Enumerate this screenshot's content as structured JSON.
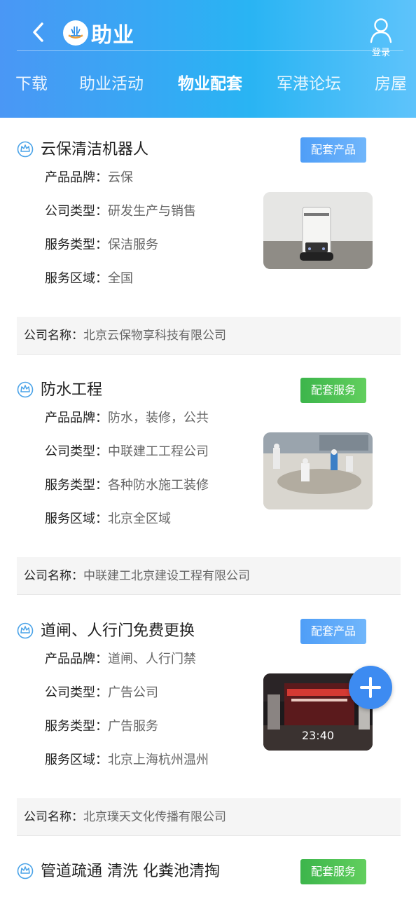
{
  "header": {
    "logo_text": "助业",
    "login_label": "登录",
    "tabs": [
      "下载",
      "助业活动",
      "物业配套",
      "军港论坛",
      "房屋"
    ],
    "active_tab": "物业配套"
  },
  "labels": {
    "brand": "产品品牌：",
    "company_type": "公司类型：",
    "service_type": "服务类型：",
    "service_area": "服务区域：",
    "company_name": "公司名称："
  },
  "listings": [
    {
      "title": "云保清洁机器人",
      "badge": "配套产品",
      "badge_color": "#4f9ef7",
      "brand": "云保",
      "company_type": "研发生产与销售",
      "service_type": "保洁服务",
      "service_area": "全国",
      "company_name": "北京云保物享科技有限公司",
      "image": "cleaning-robot"
    },
    {
      "title": "防水工程",
      "badge": "配套服务",
      "badge_color": "#3cb54b",
      "brand": "防水，装修，公共",
      "company_type": "中联建工工程公司",
      "service_type": "各种防水施工装修",
      "service_area": "北京全区域",
      "company_name": "中联建工北京建设工程有限公司",
      "image": "construction-workers"
    },
    {
      "title": "道闸、人行门免费更换",
      "badge": "配套产品",
      "badge_color": "#4f9ef7",
      "brand": "道闸、人行门禁",
      "company_type": "广告公司",
      "service_type": "广告服务",
      "service_area": "北京上海杭州温州",
      "company_name": "北京璞天文化传播有限公司",
      "image": "gate-night-video",
      "image_time": "23:40"
    },
    {
      "title": "管道疏通 清洗 化粪池清掏",
      "badge": "配套服务",
      "badge_color": "#3cb54b"
    }
  ]
}
